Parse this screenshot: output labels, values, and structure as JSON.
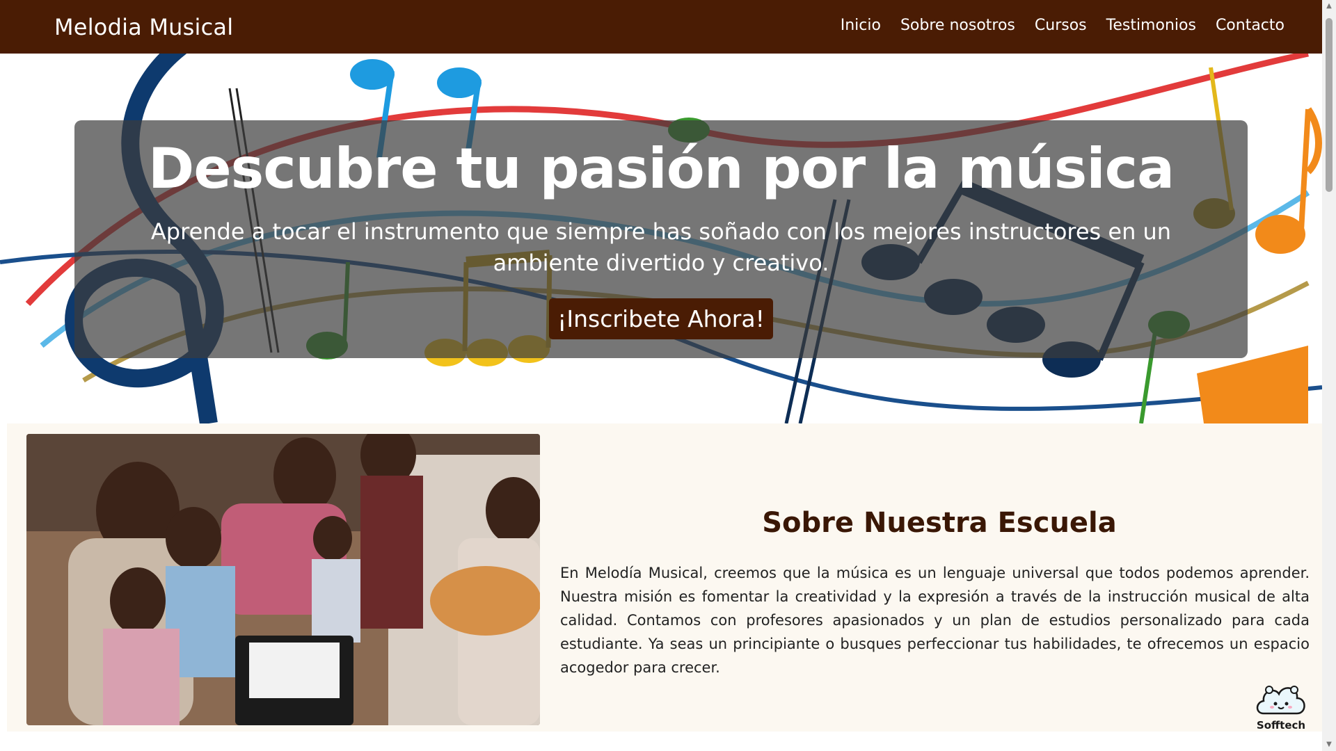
{
  "navbar": {
    "brand": "Melodia Musical",
    "links": [
      "Inicio",
      "Sobre nosotros",
      "Cursos",
      "Testimonios",
      "Contacto"
    ]
  },
  "hero": {
    "title": "Descubre tu pasión por la música",
    "subtitle": "Aprende a tocar el instrumento que siempre has soñado con los mejores instructores en un ambiente divertido y creativo.",
    "cta": "¡Inscribete Ahora!"
  },
  "about": {
    "title": "Sobre Nuestra Escuela",
    "text": "En Melodía Musical, creemos que la música es un lenguaje universal que todos podemos aprender. Nuestra misión es fomentar la creatividad y la expresión a través de la instrucción musical de alta calidad. Contamos con profesores apasionados y un plan de estudios personalizado para cada estudiante. Ya seas un principiante o busques perfeccionar tus habilidades, te ofrecemos un espacio acogedor para crecer."
  },
  "badge": {
    "label": "Sofftech",
    "icon": "cloud-mascot-icon"
  },
  "colors": {
    "nav_bg": "#4a1c04",
    "cta_bg": "#4a1c04",
    "about_bg": "#fcf8f1",
    "about_title": "#3a1705"
  }
}
